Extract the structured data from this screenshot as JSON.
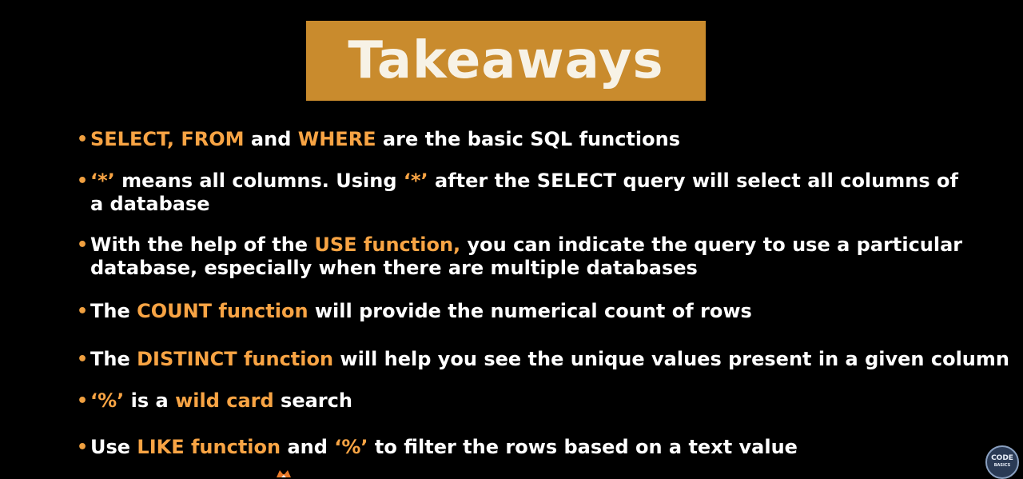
{
  "title": "Takeaways",
  "bullets": [
    {
      "parts": [
        {
          "t": "SELECT, FROM",
          "hl": true
        },
        {
          "t": " and ",
          "hl": false
        },
        {
          "t": "WHERE",
          "hl": true
        },
        {
          "t": " are the basic SQL functions",
          "hl": false
        }
      ]
    },
    {
      "parts": [
        {
          "t": "‘*’",
          "hl": true
        },
        {
          "t": " means all columns. Using ",
          "hl": false
        },
        {
          "t": "‘*’",
          "hl": true
        },
        {
          "t": " after the SELECT query will select all columns of",
          "hl": false
        }
      ],
      "cont": "a database"
    },
    {
      "parts": [
        {
          "t": "With the help of the ",
          "hl": false
        },
        {
          "t": "USE function,",
          "hl": true
        },
        {
          "t": " you can indicate the query to use a particular",
          "hl": false
        }
      ],
      "cont": "database, especially when there are multiple databases"
    },
    {
      "parts": [
        {
          "t": "The ",
          "hl": false
        },
        {
          "t": "COUNT function",
          "hl": true
        },
        {
          "t": " will provide the numerical count of rows",
          "hl": false
        }
      ]
    },
    {
      "parts": [
        {
          "t": "The ",
          "hl": false
        },
        {
          "t": "DISTINCT function",
          "hl": true
        },
        {
          "t": " will help you see the unique values present in a given column",
          "hl": false
        }
      ]
    },
    {
      "parts": [
        {
          "t": "‘%’",
          "hl": true
        },
        {
          "t": " is a ",
          "hl": false
        },
        {
          "t": "wild card",
          "hl": true
        },
        {
          "t": " search",
          "hl": false
        }
      ]
    },
    {
      "parts": [
        {
          "t": "Use ",
          "hl": false
        },
        {
          "t": "LIKE function",
          "hl": true
        },
        {
          "t": " and ",
          "hl": false
        },
        {
          "t": "‘%’",
          "hl": true
        },
        {
          "t": " to filter the rows based on a text value",
          "hl": false
        }
      ]
    }
  ],
  "logo": {
    "main": "CODE",
    "sub": "BASICS"
  },
  "colors": {
    "accent": "#f8a444",
    "title_bg": "#c98b2d",
    "background": "#000000"
  }
}
